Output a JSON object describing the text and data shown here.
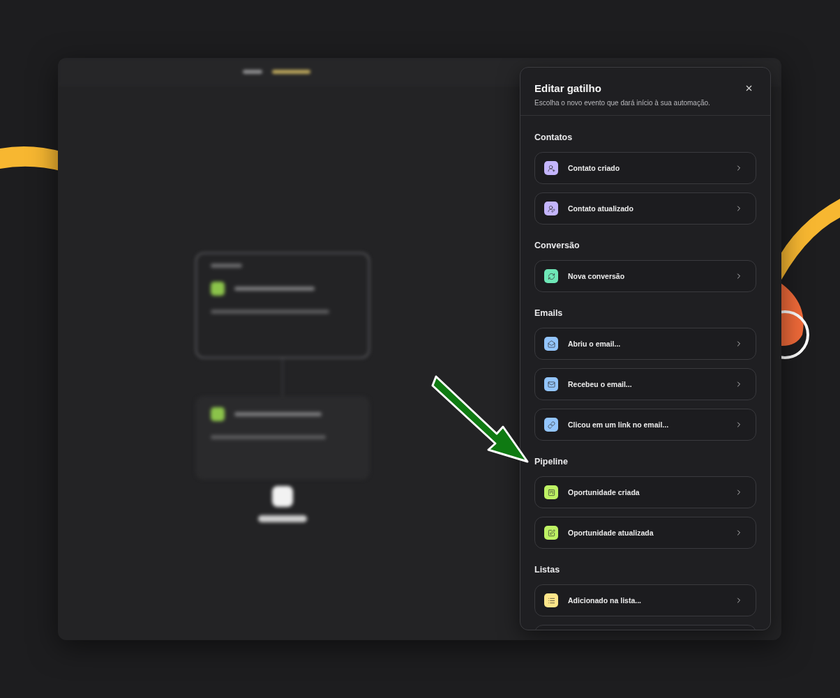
{
  "panel": {
    "title": "Editar gatilho",
    "subtitle": "Escolha o novo evento que dará início à sua automação."
  },
  "sections": [
    {
      "heading": "Contatos",
      "items": [
        {
          "label": "Contato criado",
          "kind": "contact-add",
          "color": "#c4b5fd"
        },
        {
          "label": "Contato atualizado",
          "kind": "contact-edit",
          "color": "#c4b5fd"
        }
      ]
    },
    {
      "heading": "Conversão",
      "items": [
        {
          "label": "Nova conversão",
          "kind": "refresh",
          "color": "#6ee7b7"
        }
      ]
    },
    {
      "heading": "Emails",
      "items": [
        {
          "label": "Abriu o email...",
          "kind": "mail-open",
          "color": "#93c5fd"
        },
        {
          "label": "Recebeu o email...",
          "kind": "mail",
          "color": "#93c5fd"
        },
        {
          "label": "Clicou em um link no email...",
          "kind": "link",
          "color": "#93c5fd"
        }
      ]
    },
    {
      "heading": "Pipeline",
      "items": [
        {
          "label": "Oportunidade criada",
          "kind": "card-add",
          "color": "#bef264"
        },
        {
          "label": "Oportunidade atualizada",
          "kind": "card-edit",
          "color": "#bef264"
        }
      ]
    },
    {
      "heading": "Listas",
      "items": [
        {
          "label": "Adicionado na lista...",
          "kind": "list",
          "color": "#fde68a"
        }
      ]
    }
  ]
}
